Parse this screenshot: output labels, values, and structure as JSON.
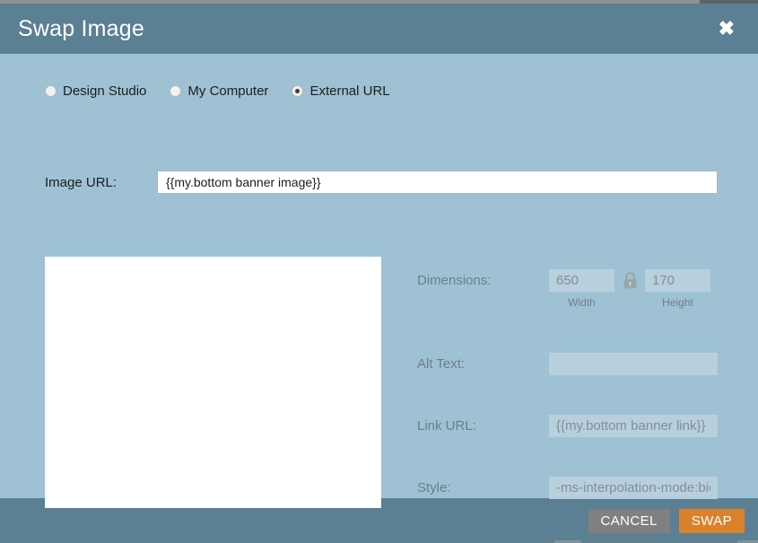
{
  "dialog": {
    "title": "Swap Image",
    "close_icon": "close-icon"
  },
  "source_options": {
    "items": [
      {
        "label": "Design Studio",
        "selected": false
      },
      {
        "label": "My Computer",
        "selected": false
      },
      {
        "label": "External URL",
        "selected": true
      }
    ]
  },
  "image_url": {
    "label": "Image URL:",
    "value": "{{my.bottom banner image}}",
    "placeholder": ""
  },
  "preview": {
    "name": "image-preview",
    "background": "#ffffff"
  },
  "properties": {
    "dimensions": {
      "label": "Dimensions:",
      "width_value": "650",
      "width_caption": "Width",
      "height_value": "170",
      "height_caption": "Height",
      "lock_icon": "lock-icon",
      "locked": true
    },
    "alt_text": {
      "label": "Alt Text:",
      "value": "",
      "placeholder": ""
    },
    "link_url": {
      "label": "Link URL:",
      "value": "{{my.bottom banner link}}",
      "placeholder": ""
    },
    "style": {
      "label": "Style:",
      "value": "-ms-interpolation-mode:bic",
      "placeholder": ""
    }
  },
  "footer": {
    "cancel_label": "CANCEL",
    "swap_label": "SWAP"
  },
  "colors": {
    "header": "#5b7f93",
    "body": "#9ec2d3",
    "field": "#b8d0dd",
    "accent": "#d9822b",
    "cancel": "#808080",
    "label_muted": "#6d7e88"
  }
}
